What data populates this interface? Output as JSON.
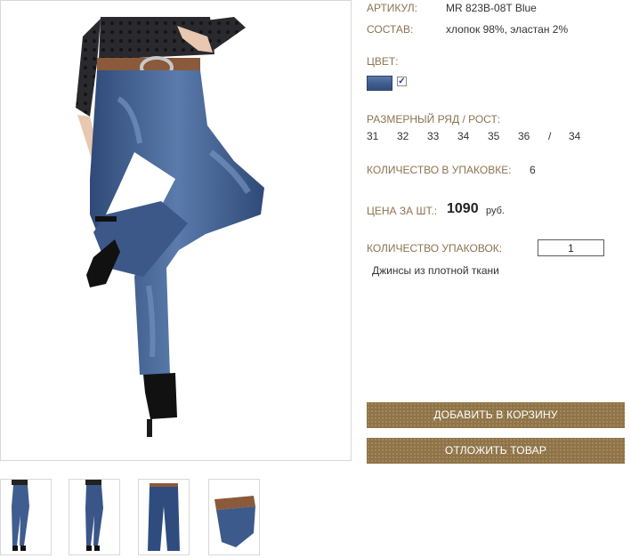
{
  "product": {
    "article_label": "АРТИКУЛ:",
    "article_value": "MR 823B-08T Blue",
    "composition_label": "СОСТАВ:",
    "composition_value": "хлопок 98%, эластан 2%",
    "color_label": "ЦВЕТ:",
    "color_swatch": "#4a6795",
    "color_checked": "✓",
    "size_label": "РАЗМЕРНЫЙ РЯД / РОСТ:",
    "sizes": [
      "31",
      "32",
      "33",
      "34",
      "35",
      "36"
    ],
    "size_separator": "/",
    "height": "34",
    "pack_label": "КОЛИЧЕСТВО В УПАКОВКЕ:",
    "pack_value": "6",
    "price_label": "ЦЕНА ЗА ШТ.:",
    "price_value": "1090",
    "price_currency": "руб.",
    "packs_label": "КОЛИЧЕСТВО УПАКОВОК:",
    "packs_value": "1",
    "description": "Джинсы из плотной ткани"
  },
  "buttons": {
    "add_to_cart": "ДОБАВИТЬ В КОРЗИНУ",
    "postpone": "ОТЛОЖИТЬ ТОВАР"
  },
  "colors": {
    "label_brown": "#8c7350",
    "button_brown": "#8f7449",
    "denim": "#3d5a8a"
  },
  "thumbnails": [
    "front-view",
    "back-view",
    "flat-view",
    "detail-view"
  ]
}
